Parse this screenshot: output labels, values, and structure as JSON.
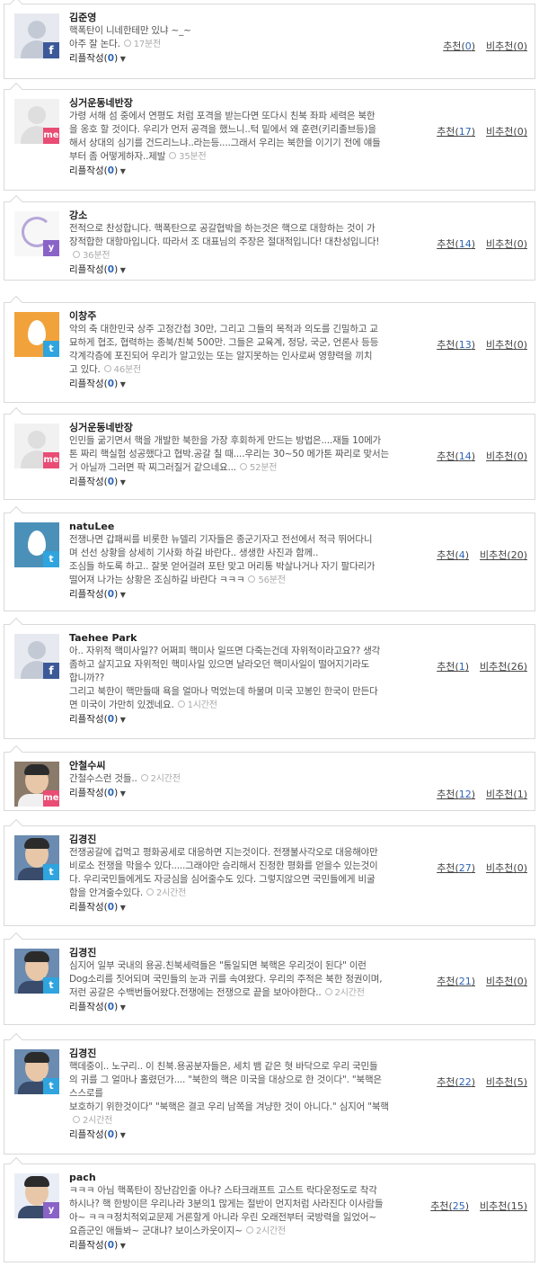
{
  "reply_label": "리플작성",
  "up_label": "추천",
  "down_label": "비추천",
  "comments": [
    {
      "author": "김준영",
      "network": "facebook",
      "avatar": "fb",
      "lines": [
        "핵폭탄이 니네한테만 있냐 ~_~",
        "아주 잘 논다."
      ],
      "time": "17분전",
      "replies": "0",
      "up": "0",
      "down": "0"
    },
    {
      "author": "싱거운동네반장",
      "network": "me2day",
      "avatar": "blank",
      "lines": [
        "가령 서해 섬 중에서 연평도 처럼 포격을 받는다면 또다시 친북 좌파 세력은 북한",
        "을 옹호 할 것이다. 우리가 먼저 공격을 했느니..턱 밑에서 왜 훈련(키리졸브등)을",
        "해서 상대의 심기를 건드리느냐..라는등....그래서 우리는 북한을 이기기 전에 얘들",
        "부터 좀 어떻게하자..제발"
      ],
      "time": "35분전",
      "replies": "0",
      "up": "17",
      "down": "0"
    },
    {
      "author": "강소",
      "network": "yozm",
      "avatar": "spiral",
      "lines": [
        "전적으로 찬성합니다. 핵폭탄으로 공갈협박을 하는것은 핵으로 대항하는 것이 가",
        "장적합한 대항마입니다. 따라서 조 대표님의 주장은 절대적입니다! 대찬성입니다!"
      ],
      "time": "36분전",
      "replies": "0",
      "up": "14",
      "down": "0"
    },
    {
      "author": "이창주",
      "network": "twitter",
      "avatar": "egg",
      "lines": [
        "악의 축 대한민국 상주 고정간첩 30만, 그리고 그들의 목적과 의도를 긴밀하고 교",
        "묘하게 협조, 협력하는 종북/친북 500만. 그들은 교육계, 정당, 국군, 언론사 등등",
        "각계각층에 포진되어 우리가 알고있는 또는 알지못하는 인사로써 영향력을 끼치",
        "고 있다."
      ],
      "time": "46분전",
      "replies": "0",
      "up": "13",
      "down": "0"
    },
    {
      "author": "싱거운동네반장",
      "network": "me2day",
      "avatar": "blank",
      "lines": [
        "인민들 굶기면서 핵을 개발한 북한을 가장 후회하게 만드는 방법은....재들 10메가",
        "톤 짜리 핵실험 성공했다고 협박.공갈 칠 때....우리는 30~50 메가톤 짜리로 맞서는",
        "거 아닐까 그러면 팍 찌그러질거 같으네요..."
      ],
      "time": "52분전",
      "replies": "0",
      "up": "14",
      "down": "0"
    },
    {
      "author": "natuLee",
      "network": "twitter",
      "avatar": "egg2",
      "lines": [
        "전쟁나면 갑패씨를 비롯한 뉴델리 기자들은 종군기자고 전선에서 적극 뛰어다니",
        "며 선선 상황을 상세히 기사화 하길 바란다.. 생생한 사진과 함께..",
        "조심들 하도록 하고.. 잘못 얻어걸려 포탄 맞고 머리통 박살나거나 자기 팔다리가",
        "떨어져 나가는 상황은 조심하길 바란다 ㅋㅋㅋ"
      ],
      "time": "56분전",
      "replies": "0",
      "up": "4",
      "down": "20"
    },
    {
      "author": "Taehee Park",
      "network": "facebook",
      "avatar": "fb",
      "lines": [
        "아.. 자위적 핵미사일?? 어쩌피 핵미사 일뜨면 다죽는건데 자위적이라고요?? 생각",
        "좀하고 살지고요 자위적인 핵미사일 있으면 날라오던 핵미사일이 떨어지기라도",
        "합니까??",
        "그리고 북한이 핵만들때 욕을 얼마나 먹었는데 하물며 미국 꼬봉인 한국이 만든다",
        "면 미국이 가만히 있겠네요."
      ],
      "time": "1시간전",
      "replies": "0",
      "up": "1",
      "down": "26"
    },
    {
      "author": "안철수씨",
      "network": "me2day",
      "avatar": "photo",
      "lines": [
        "간철수스런 것들.."
      ],
      "time": "2시간전",
      "replies": "0",
      "up": "12",
      "down": "1"
    },
    {
      "author": "김경진",
      "network": "twitter",
      "avatar": "photo2",
      "lines": [
        "전쟁공갈에 겁먹고 평화공세로 대응하면 지는것이다. 전쟁불사각오로 대응해야만",
        "비로소 전쟁을 막을수 있다.....그래야만 승리해서 진정한 평화를 얻을수 있는것이",
        "다. 우리국민들에게도 자긍심을 심어줄수도 있다. 그렇지않으면 국민들에게 비굴",
        "함을 안겨줄수있다."
      ],
      "time": "2시간전",
      "replies": "0",
      "up": "27",
      "down": "0"
    },
    {
      "author": "김경진",
      "network": "twitter",
      "avatar": "photo2",
      "lines": [
        "심지어 일부 국내의 용공.친북세력들은 \"통일되면 북핵은 우리것이 된다\" 이런",
        "Dog소리를 짓어되며 국민들의 눈과 귀를 속여왔다. 우리의 주적은 북한 정권이며,",
        "저런 공갈은 수백번들어왔다.전쟁에는 전쟁으로 끝을 보아야한다.."
      ],
      "time": "2시간전",
      "replies": "0",
      "up": "21",
      "down": "0"
    },
    {
      "author": "김경진",
      "network": "twitter",
      "avatar": "photo2",
      "lines": [
        "핵데중이.. 노구리.. 이 친북.용공분자들은, 세치 뱀 같은 혓 바닥으로 우리 국민들",
        "의 귀를 그 얼마나 홀렸던가.... \"북한의 핵은 미국을 대상으로 한 것이다\". \"북핵은",
        "스스로를",
        "보호하기 위한것이다\" \"북핵은 결코 우리 남쪽을 겨냥한 것이 아니다.\" 심지어 \"북핵"
      ],
      "time": "2시간전",
      "replies": "0",
      "up": "22",
      "down": "5"
    },
    {
      "author": "pach",
      "network": "yozm",
      "avatar": "pach",
      "lines": [
        "ㅋㅋㅋ 아님 핵폭탄이 장난감인줄 아나? 스타크래프트 고스트 락다운정도로 착각",
        "하시나? 핵 한방이믄 우리나라 3분의1 많게는 절반이 먼지처럼 사라진다 이사람들",
        "아~ ㅋㅋㅋ정치적외교문제 거론할게 아니라 우린 오래전부터 국방력을 잃었어~",
        "요즘군인 애들봐~ 군대냐? 보이스카웃이지~"
      ],
      "time": "2시간전",
      "replies": "0",
      "up": "25",
      "down": "15"
    }
  ]
}
